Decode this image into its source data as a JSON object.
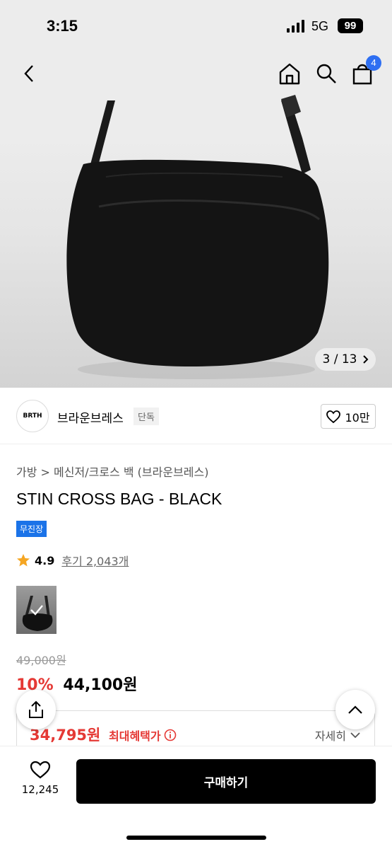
{
  "status": {
    "time": "3:15",
    "network": "5G",
    "battery": "99"
  },
  "nav": {
    "cart_count": "4"
  },
  "gallery": {
    "current": "3",
    "total": "13",
    "separator": "/"
  },
  "brand": {
    "name": "브라운브레스",
    "exclusive_tag": "단독",
    "logo_text": "BRTH",
    "likes": "10만"
  },
  "breadcrumb": {
    "category": "가방",
    "separator": ">",
    "subcategory": "메신저/크로스 백",
    "brand": "(브라운브레스)"
  },
  "product": {
    "title": "STIN CROSS BAG - BLACK",
    "shipping_badge": "무진장",
    "rating": "4.9",
    "review_label": "후기 2,043개"
  },
  "price": {
    "original": "49,000원",
    "discount": "10%",
    "current": "44,100원",
    "max_benefit_price": "34,795원",
    "max_benefit_label": "최대혜택가",
    "details_label": "자세히"
  },
  "bottom_bar": {
    "wish_count": "12,245",
    "buy_label": "구매하기"
  },
  "colors": {
    "accent_blue": "#2e6ff2",
    "sale_red": "#e53935",
    "badge_blue": "#1b73e8"
  }
}
